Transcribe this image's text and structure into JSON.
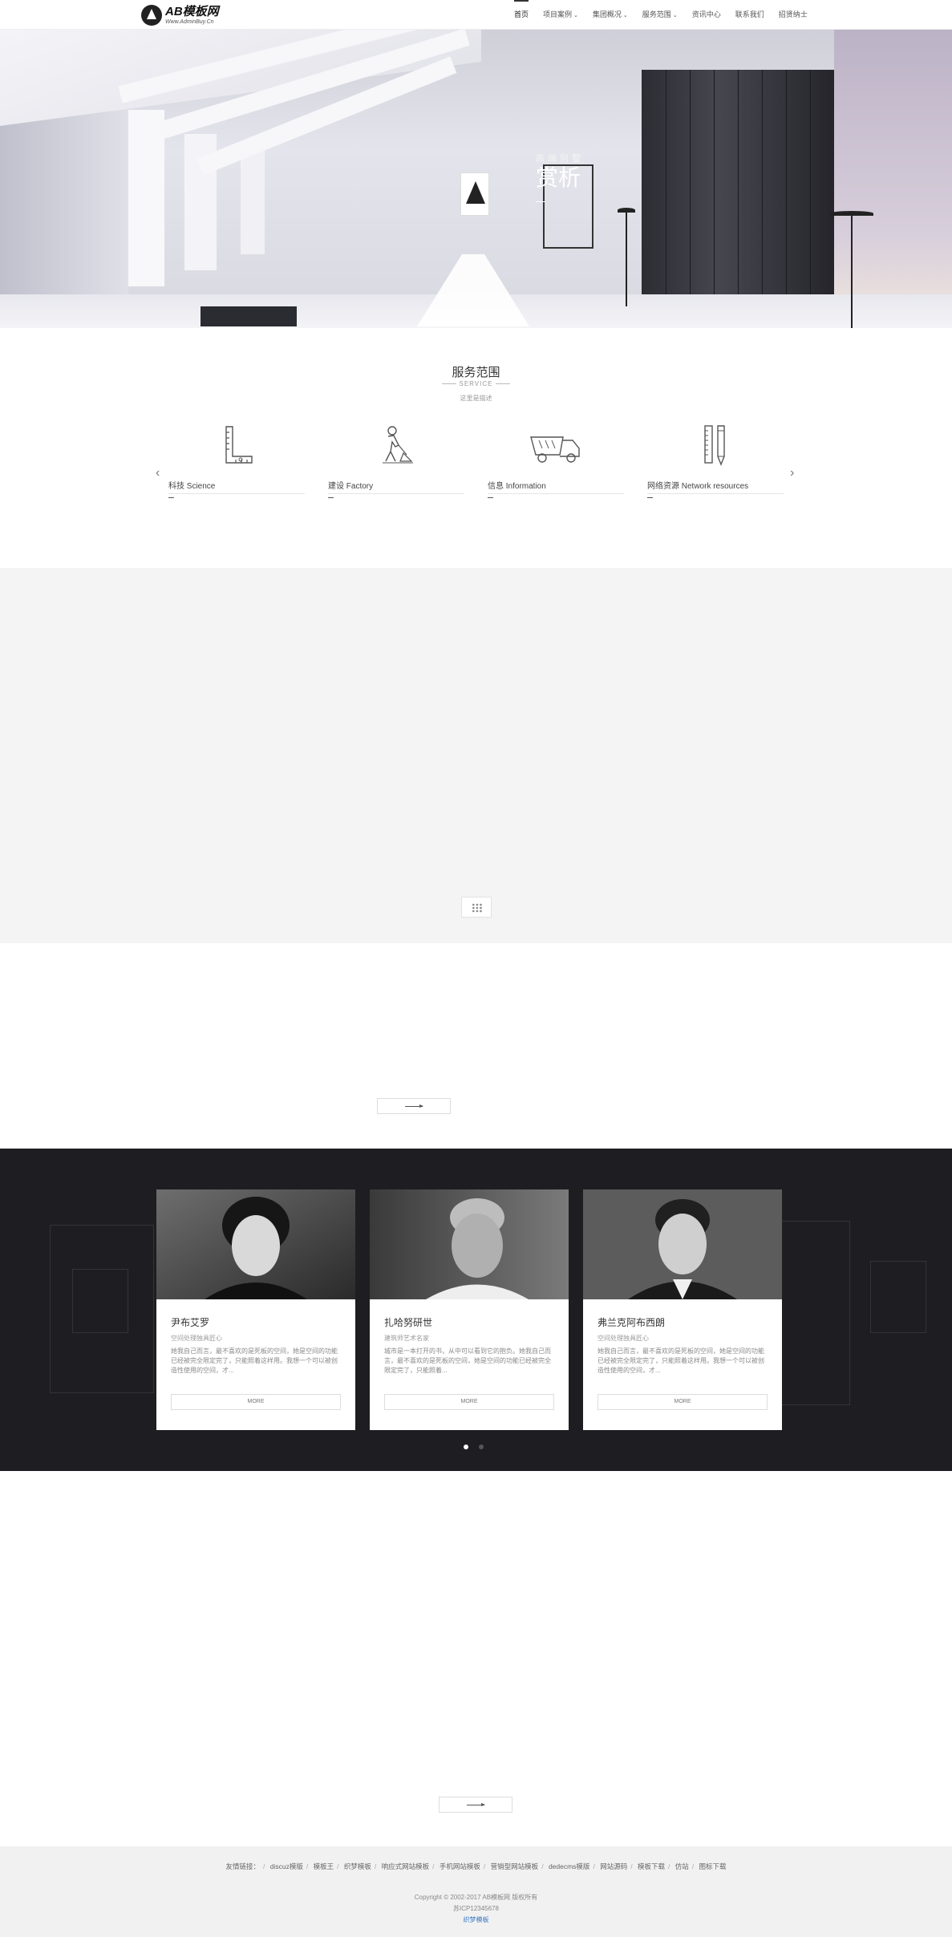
{
  "header": {
    "logo_name": "AB模板网",
    "logo_sub": "Www.AdminBuy.Cn",
    "nav": [
      {
        "label": "首页",
        "dropdown": false,
        "active": true
      },
      {
        "label": "项目案例",
        "dropdown": true
      },
      {
        "label": "集团概况",
        "dropdown": true
      },
      {
        "label": "服务范围",
        "dropdown": true
      },
      {
        "label": "资讯中心",
        "dropdown": false
      },
      {
        "label": "联系我们",
        "dropdown": false
      },
      {
        "label": "招贤纳士",
        "dropdown": false
      }
    ]
  },
  "hero": {
    "subtitle": "高端别墅",
    "title": "赏析"
  },
  "service": {
    "title": "服务范围",
    "subtitle_en": "SERVICE",
    "desc": "这里是描述",
    "prev_icon": "chevron-left-icon",
    "next_icon": "chevron-right-icon",
    "items": [
      {
        "label": "科技 Science",
        "icon": "ruler-icon"
      },
      {
        "label": "建设 Factory",
        "icon": "worker-icon"
      },
      {
        "label": "信息 Information",
        "icon": "truck-icon"
      },
      {
        "label": "网络资源 Network resources",
        "icon": "ruler-pencil-icon"
      }
    ]
  },
  "grey": {
    "grid_icon": "grid-icon"
  },
  "team": {
    "cards": [
      {
        "name": "尹布艾罗",
        "role": "空间处理独具匠心",
        "desc": "她我自己而言，最不喜欢的是死板的空间，她是空间的功能已经被完全限定完了，只能照着这样用。我想一个可以被创造性使用的空间，才...",
        "button": "MORE"
      },
      {
        "name": "扎哈努研世",
        "role": "建筑师艺术名家",
        "desc": "城市是一本打开的书，从中可以看到它的抱负。她我自己而言，最不喜欢的是死板的空间，她是空间的功能已经被完全限定完了，只能照着...",
        "button": "MORE"
      },
      {
        "name": "弗兰克阿布西朗",
        "role": "空间处理独具匠心",
        "desc": "她我自己而言，最不喜欢的是死板的空间，她是空间的功能已经被完全限定完了，只能照着这样用。我想一个可以被创造性使用的空间，才...",
        "button": "MORE"
      }
    ],
    "active_dot": 0
  },
  "footer": {
    "links_label": "友情链接：",
    "links": [
      "discuz模版",
      "模板王",
      "织梦模板",
      "响应式网站模板",
      "手机网站模板",
      "营销型网站模板",
      "dedecms模版",
      "网站源码",
      "模板下载",
      "仿站",
      "图标下载"
    ],
    "copyright": "Copyright © 2002-2017 AB模板网 版权所有",
    "icp": "苏ICP12345678",
    "powered": "织梦模板"
  }
}
